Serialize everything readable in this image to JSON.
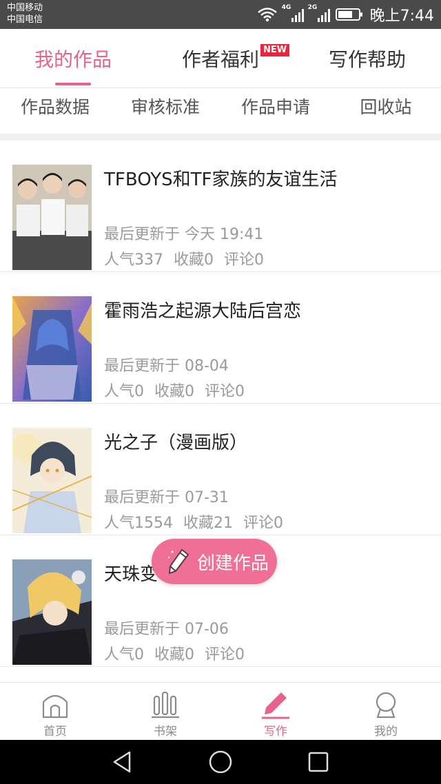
{
  "status_bar": {
    "carrier_1": "中国移动",
    "carrier_2": "中国电信",
    "net_1": "4G",
    "net_2": "2G",
    "time": "晚上7:44",
    "battery_level": 0.7,
    "icons": [
      "wifi-icon",
      "signal-icon",
      "signal-icon",
      "battery-icon"
    ]
  },
  "tabs": [
    {
      "label": "我的作品",
      "active": true
    },
    {
      "label": "作者福利",
      "badge": "NEW",
      "active": false
    },
    {
      "label": "写作帮助",
      "active": false
    }
  ],
  "subnav": [
    "作品数据",
    "审核标准",
    "作品申请",
    "回收站"
  ],
  "works": [
    {
      "title": "TFBOYS和TF家族的友谊生活",
      "updated": "最后更新于 今天 19:41",
      "popularity": "人气337",
      "favorites": "收藏0",
      "comments": "评论0"
    },
    {
      "title": "霍雨浩之起源大陆后宫恋",
      "updated": "最后更新于 08-04",
      "popularity": "人气0",
      "favorites": "收藏0",
      "comments": "评论0"
    },
    {
      "title": "光之子（漫画版）",
      "updated": "最后更新于 07-31",
      "popularity": "人气1554",
      "favorites": "收藏21",
      "comments": "评论0"
    },
    {
      "title": "天珠变",
      "updated": "最后更新于 07-06",
      "popularity": "人气0",
      "favorites": "收藏0",
      "comments": "评论0"
    }
  ],
  "fab": {
    "label": "创建作品",
    "icon": "pencil-icon"
  },
  "bottom_nav": [
    {
      "label": "首页",
      "icon": "home-icon",
      "active": false
    },
    {
      "label": "书架",
      "icon": "bookshelf-icon",
      "active": false
    },
    {
      "label": "写作",
      "icon": "pencil-icon",
      "active": true
    },
    {
      "label": "我的",
      "icon": "profile-icon",
      "active": false
    }
  ],
  "colors": {
    "accent": "#e8638a",
    "fab": "#f06f96",
    "badge": "#e8243f",
    "status_bar": "#4a4a4a"
  }
}
